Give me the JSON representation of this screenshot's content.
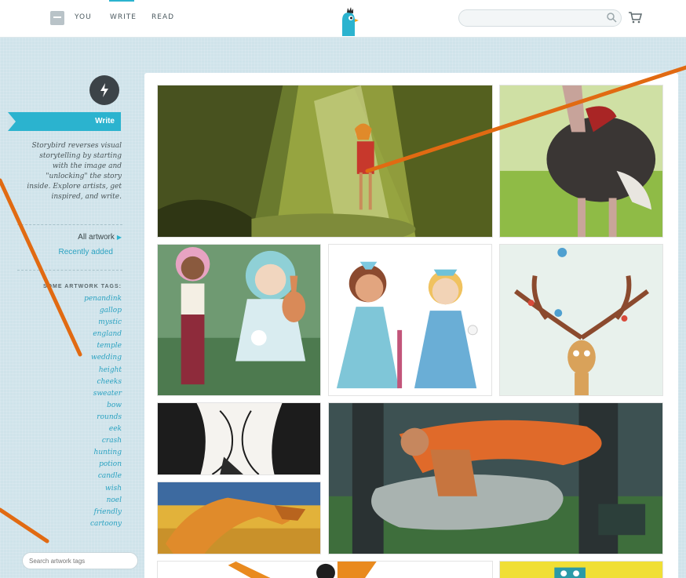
{
  "nav": {
    "you": "YOU",
    "write": "WRITE",
    "read": "READ"
  },
  "sidebar": {
    "write_label": "Write",
    "intro": "Storybird reverses visual storytelling by starting with the image and \"unlocking\" the story inside. Explore artists, get inspired, and write.",
    "all_artwork": "All artwork",
    "recently_added": "Recently added",
    "tags_header": "SOME ARTWORK TAGS:",
    "tags": [
      "penandink",
      "gallop",
      "mystic",
      "england",
      "temple",
      "wedding",
      "height",
      "cheeks",
      "sweater",
      "bow",
      "rounds",
      "eek",
      "crash",
      "hunting",
      "potion",
      "candle",
      "wish",
      "noel",
      "friendly",
      "cartoony"
    ],
    "search_placeholder": "Search artwork tags"
  },
  "colors": {
    "accent": "#2bb3cf",
    "arrow": "#e16a12",
    "background": "#cfe3ea"
  },
  "icons": [
    "doc-icon",
    "bird-logo-icon",
    "search-icon",
    "cart-icon",
    "bolt-icon",
    "caret-right-icon"
  ]
}
